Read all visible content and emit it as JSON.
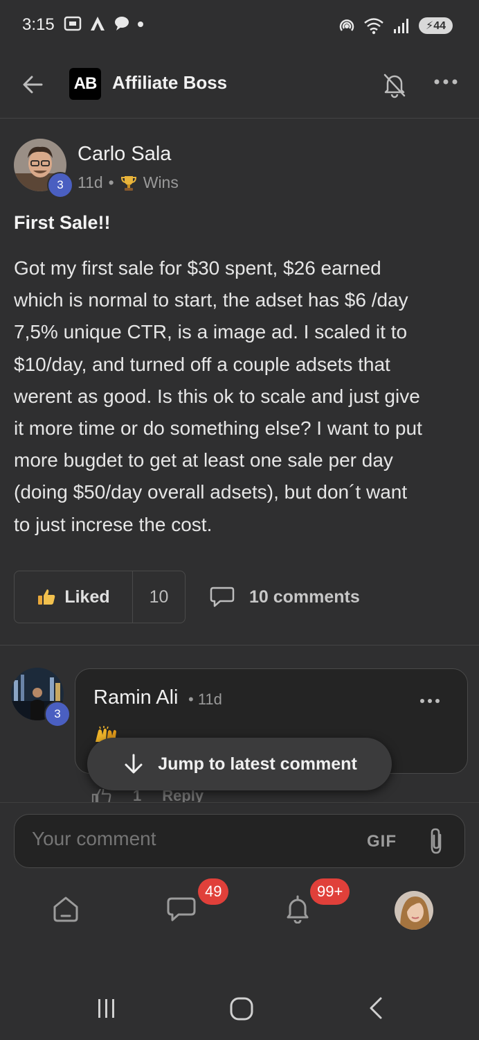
{
  "status_bar": {
    "time": "3:15",
    "battery": "44"
  },
  "header": {
    "logo_text": "AB",
    "group_name": "Affiliate Boss"
  },
  "post": {
    "author": "Carlo Sala",
    "level": "3",
    "time": "11d",
    "separator": "•",
    "category": "Wins",
    "title": "First Sale!!",
    "body_lines": [
      "Got my first sale for $30 spent, $26 earned",
      "which is normal to start, the adset has $6 /day",
      "7,5% unique CTR, is a image ad. I scaled it to",
      "$10/day, and turned off a couple adsets that",
      "werent as good. Is this ok to scale and just give",
      "it more time or do something else? I want to put",
      "more bugdet to get at least one sale per day",
      "(doing $50/day overall adsets), but don´t want",
      "to just increse the cost."
    ],
    "like_label": "Liked",
    "like_count": "10",
    "comments_label": "10 comments"
  },
  "comment": {
    "author": "Ramin Ali",
    "level": "3",
    "time_prefix": "•",
    "time": "11d",
    "like_count": "1",
    "reply_label": "Reply"
  },
  "jump_button": {
    "label": "Jump to latest comment"
  },
  "composer": {
    "placeholder": "Your comment",
    "gif_label": "GIF"
  },
  "bottom_nav": {
    "chat_badge": "49",
    "notifications_badge": "99+"
  },
  "colors": {
    "background": "#2f2f30",
    "badge": "#e0403a",
    "level_badge": "#4a5fc1"
  }
}
